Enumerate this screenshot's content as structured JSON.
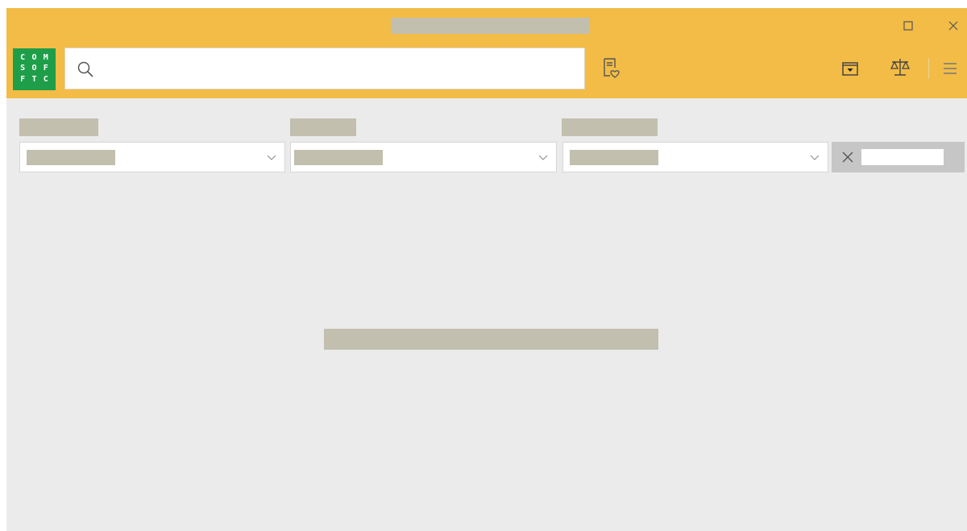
{
  "window": {
    "title": ""
  },
  "toolbar": {
    "logo_letters": [
      "C",
      "O",
      "M",
      "S",
      "O",
      "F",
      "F",
      "T",
      "C"
    ],
    "search_placeholder": ""
  },
  "filters": [
    {
      "label": "",
      "value": ""
    },
    {
      "label": "",
      "value": ""
    },
    {
      "label": "",
      "value": ""
    }
  ],
  "clear_filters_label": "",
  "main_message": "",
  "colors": {
    "accent": "#f2bc46",
    "logo_green": "#1f9e4a",
    "background": "#ebebeb",
    "redacted": "#c2bfae"
  },
  "icons": {
    "search": "search-icon",
    "favorites": "favorites-icon",
    "folder": "folder-icon",
    "scale": "scale-icon",
    "menu": "menu-icon",
    "maximize": "maximize-icon",
    "close": "close-icon",
    "chevron": "chevron-down-icon",
    "clear": "close-icon"
  }
}
